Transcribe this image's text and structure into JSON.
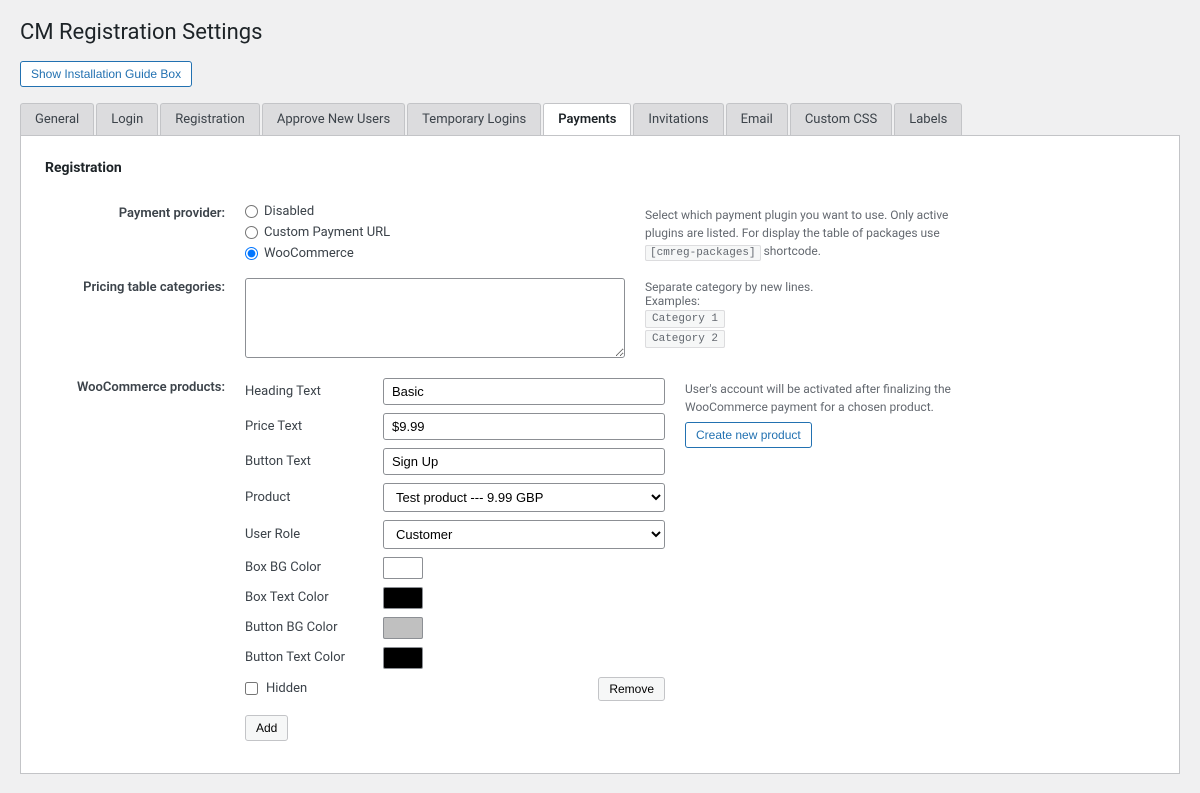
{
  "page": {
    "title": "CM Registration Settings",
    "show_guide_btn": "Show Installation Guide Box"
  },
  "tabs": [
    {
      "id": "general",
      "label": "General",
      "active": false
    },
    {
      "id": "login",
      "label": "Login",
      "active": false
    },
    {
      "id": "registration",
      "label": "Registration",
      "active": false
    },
    {
      "id": "approve-new-users",
      "label": "Approve New Users",
      "active": false
    },
    {
      "id": "temporary-logins",
      "label": "Temporary Logins",
      "active": false
    },
    {
      "id": "payments",
      "label": "Payments",
      "active": true
    },
    {
      "id": "invitations",
      "label": "Invitations",
      "active": false
    },
    {
      "id": "email",
      "label": "Email",
      "active": false
    },
    {
      "id": "custom-css",
      "label": "Custom CSS",
      "active": false
    },
    {
      "id": "labels",
      "label": "Labels",
      "active": false
    }
  ],
  "section": {
    "title": "Registration",
    "payment_provider_label": "Payment provider:",
    "payment_options": [
      {
        "id": "disabled",
        "label": "Disabled",
        "checked": false
      },
      {
        "id": "custom-payment-url",
        "label": "Custom Payment URL",
        "checked": false
      },
      {
        "id": "woocommerce",
        "label": "WooCommerce",
        "checked": true
      }
    ],
    "payment_help": "Select which payment plugin you want to use. Only active plugins are listed. For display the table of packages use",
    "payment_shortcode": "[cmreg-packages]",
    "payment_help_suffix": "shortcode.",
    "pricing_label": "Pricing table categories:",
    "pricing_help_main": "Separate category by new lines.",
    "pricing_help_examples": "Examples:",
    "pricing_example1": "Category 1",
    "pricing_example2": "Category 2",
    "woo_products_label": "WooCommerce products:",
    "product_form": {
      "heading_text_label": "Heading Text",
      "heading_text_value": "Basic",
      "price_text_label": "Price Text",
      "price_text_value": "$9.99",
      "button_text_label": "Button Text",
      "button_text_value": "Sign Up",
      "product_label": "Product",
      "product_value": "Test product --- 9.99 GBP",
      "product_options": [
        "Test product --- 9.99 GBP"
      ],
      "user_role_label": "User Role",
      "user_role_value": "Customer",
      "user_role_options": [
        "Customer"
      ],
      "box_bg_color_label": "Box BG Color",
      "box_bg_color": "#ffffff",
      "box_text_color_label": "Box Text Color",
      "box_text_color": "#000000",
      "button_bg_color_label": "Button BG Color",
      "button_bg_color": "#c0c0c0",
      "button_text_color_label": "Button Text Color",
      "button_text_color": "#000000",
      "hidden_label": "Hidden",
      "remove_btn": "Remove",
      "add_btn": "Add"
    },
    "woo_help": "User's account will be activated after finalizing the WooCommerce payment for a chosen product.",
    "create_product_btn": "Create new product"
  }
}
